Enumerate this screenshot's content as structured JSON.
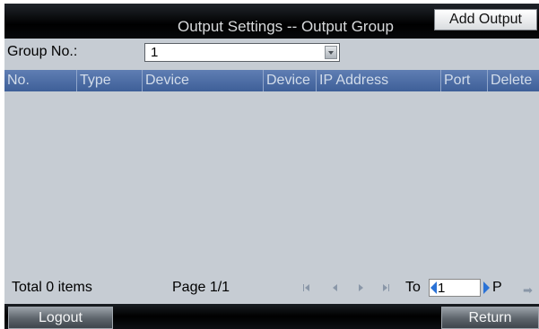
{
  "title": "Output Settings -- Output Group",
  "add_output_label": "Add Output",
  "group": {
    "label": "Group No.:",
    "value": "1"
  },
  "columns": [
    {
      "label": "No."
    },
    {
      "label": "Type"
    },
    {
      "label": "Device"
    },
    {
      "label": "Device"
    },
    {
      "label": "IP Address"
    },
    {
      "label": "Port"
    },
    {
      "label": "Delete"
    }
  ],
  "rows": [],
  "footer": {
    "total": "Total 0 items",
    "page": "Page 1/1",
    "to_label": "To",
    "page_input_value": "1",
    "p_label": "P"
  },
  "buttons": {
    "logout": "Logout",
    "return": "Return"
  },
  "colors": {
    "background": "#c6ccd3",
    "header": "#4a6aa3",
    "titlebar": "#000000",
    "spin_accent": "#2a72d6"
  }
}
